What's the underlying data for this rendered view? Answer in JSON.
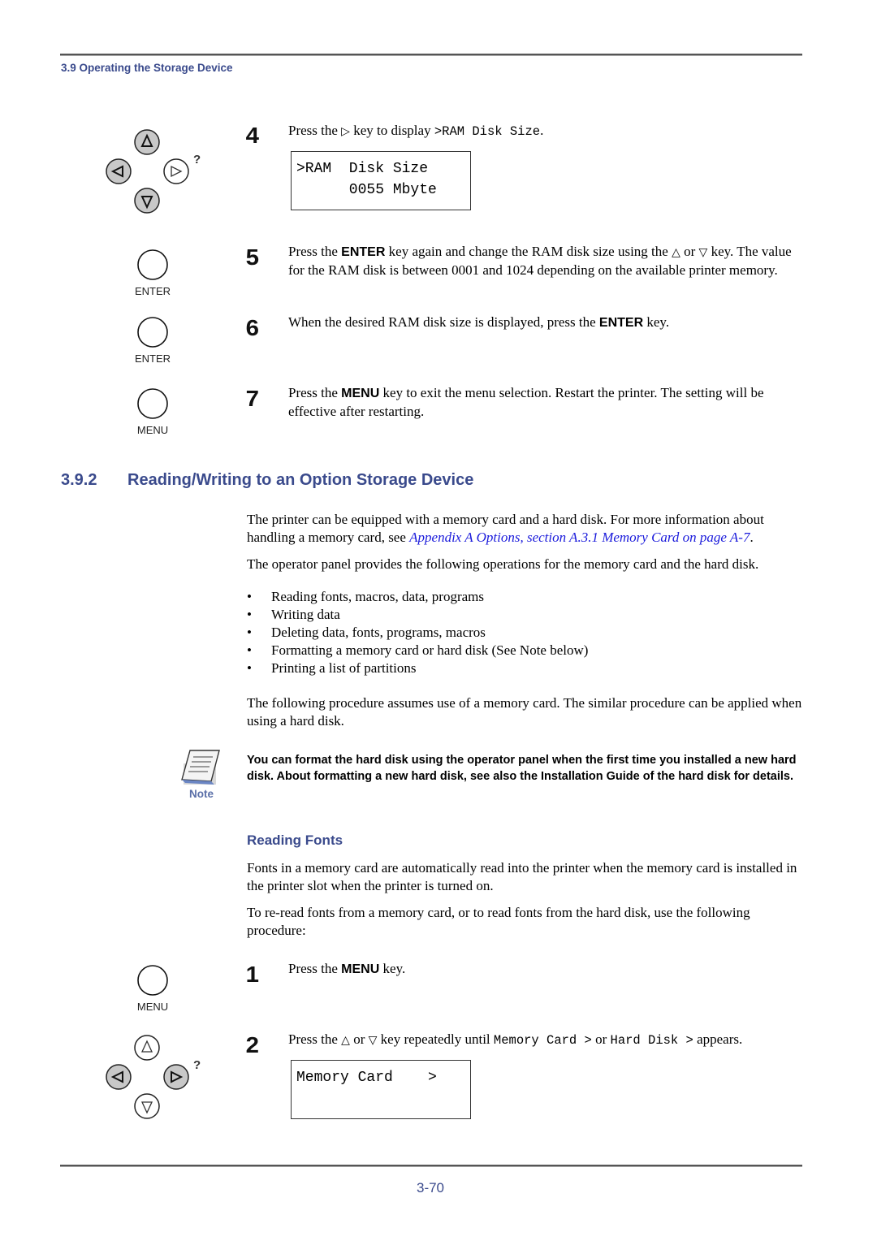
{
  "header": {
    "section_title": "3.9 Operating the Storage Device"
  },
  "upper_steps": {
    "step4": {
      "number": "4",
      "text_before": "Press the ",
      "key_glyph": "▷",
      "text_mid": " key to display ",
      "mono_text": ">RAM Disk Size",
      "text_after": ".",
      "lcd_line1": ">RAM  Disk Size",
      "lcd_line2": "      0055 Mbyte"
    },
    "step5": {
      "number": "5",
      "t1": "Press the ",
      "key": "ENTER",
      "t2": " key again and change the RAM disk size using the ",
      "up_glyph": "△",
      "t3": " or ",
      "down_glyph": "▽",
      "t4": " key. The value for the RAM disk is between 0001 and 1024 depending on the available printer memory."
    },
    "step6": {
      "number": "6",
      "t1": "When the desired RAM disk size is displayed, press the ",
      "key": "ENTER",
      "t2": " key."
    },
    "step7": {
      "number": "7",
      "t1": "Press the ",
      "key": "MENU",
      "t2": " key to exit the menu selection. Restart the printer. The setting will be effective after restarting."
    }
  },
  "panel_icons": {
    "question_mark": "?",
    "enter_label": "ENTER",
    "menu_label": "MENU",
    "up": "Δ",
    "down": "∇",
    "left": "◁",
    "right": "▷"
  },
  "section": {
    "number": "3.9.2",
    "title": "Reading/Writing to an Option Storage Device",
    "intro_1_before": "The printer can be equipped with a memory card and a hard disk. For more information about handling a memory card, see ",
    "intro_1_link": "Appendix A Options, section A.3.1 Memory Card on page A-7",
    "intro_1_after": ".",
    "intro_2": "The operator panel provides the following operations for the memory card and the hard disk.",
    "bullets": [
      "Reading fonts, macros, data, programs",
      "Writing data",
      "Deleting data, fonts, programs, macros",
      "Formatting a memory card or hard disk (See Note below)",
      "Printing a list of partitions"
    ],
    "procedure_note": "The following procedure assumes use of a memory card. The similar procedure can be applied when using a hard disk."
  },
  "note": {
    "label": "Note",
    "text": "You can format the hard disk using the operator panel when the first time you installed a new hard disk. About formatting a new hard disk, see also the Installation Guide of the hard disk for details."
  },
  "reading_fonts": {
    "heading": "Reading Fonts",
    "para1": "Fonts in a memory card are automatically read into the printer when the memory card is installed in the printer slot when the printer is turned on.",
    "para2": "To re-read fonts from a memory card, or to read fonts from the hard disk, use the following procedure:",
    "step1": {
      "number": "1",
      "t1": "Press the ",
      "key": "MENU",
      "t2": " key."
    },
    "step2": {
      "number": "2",
      "t1": "Press the ",
      "up_glyph": "△",
      "t2": " or ",
      "down_glyph": "▽",
      "t3": " key repeatedly until ",
      "mono1": "Memory Card >",
      "t4": " or ",
      "mono2": "Hard Disk >",
      "t5": " appears.",
      "lcd_line1": "Memory Card    >",
      "lcd_line2": ""
    }
  },
  "footer": {
    "page_number": "3-70"
  }
}
